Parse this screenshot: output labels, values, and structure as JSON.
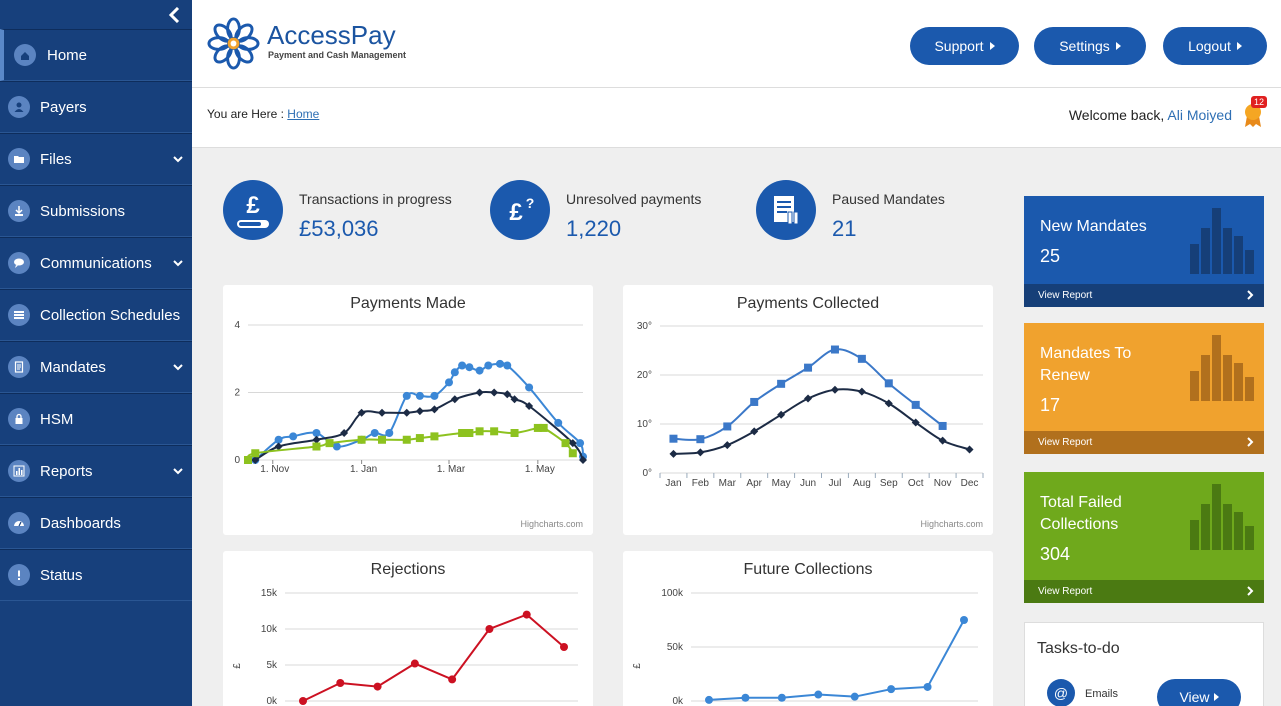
{
  "brand": {
    "name": "AccessPay",
    "tagline": "Payment and Cash Management"
  },
  "header": {
    "buttons": [
      "Support",
      "Settings",
      "Logout"
    ]
  },
  "sidebar": {
    "items": [
      {
        "label": "Home",
        "icon": "home-icon",
        "has_submenu": false,
        "active": true
      },
      {
        "label": "Payers",
        "icon": "user-icon",
        "has_submenu": false
      },
      {
        "label": "Files",
        "icon": "folder-icon",
        "has_submenu": true
      },
      {
        "label": "Submissions",
        "icon": "download-icon",
        "has_submenu": false
      },
      {
        "label": "Communications",
        "icon": "chat-icon",
        "has_submenu": true
      },
      {
        "label": "Collection Schedules",
        "icon": "list-icon",
        "has_submenu": false
      },
      {
        "label": "Mandates",
        "icon": "document-icon",
        "has_submenu": true
      },
      {
        "label": "HSM",
        "icon": "lock-icon",
        "has_submenu": false
      },
      {
        "label": "Reports",
        "icon": "bar-chart-icon",
        "has_submenu": true
      },
      {
        "label": "Dashboards",
        "icon": "dashboard-icon",
        "has_submenu": false
      },
      {
        "label": "Status",
        "icon": "exclamation-icon",
        "has_submenu": false
      }
    ]
  },
  "breadcrumb": {
    "prefix": "You are Here :",
    "link": "Home"
  },
  "welcome": {
    "text": "Welcome back,",
    "user": "Ali Moiyed",
    "notifications": "12"
  },
  "stats": [
    {
      "label": "Transactions in progress",
      "value": "£53,036",
      "icon": "pound-progress-icon"
    },
    {
      "label": "Unresolved payments",
      "value": "1,220",
      "icon": "pound-question-icon"
    },
    {
      "label": "Paused Mandates",
      "value": "21",
      "icon": "paused-document-icon"
    }
  ],
  "cards": [
    {
      "title": "New Mandates",
      "count": "25",
      "link": "View Report",
      "color": "#1b59ad",
      "footer_color": "#163f78",
      "bar_color": "#163f78"
    },
    {
      "title": "Mandates To Renew",
      "count": "17",
      "link": "View Report",
      "color": "#f0a22e",
      "footer_color": "#b1701d",
      "bar_color": "#b1701d"
    },
    {
      "title": "Total Failed Collections",
      "count": "304",
      "link": "View Report",
      "color": "#6fa91c",
      "footer_color": "#4b7a12",
      "bar_color": "#4b7a12"
    }
  ],
  "tasks": {
    "title": "Tasks-to-do",
    "item_label": "Emails",
    "button": "View"
  },
  "credit": "Highcharts.com",
  "chart_data": [
    {
      "type": "line",
      "title": "Payments Made",
      "x_ticks": [
        "1. Nov",
        "1. Jan",
        "1. Mar",
        "1. May"
      ],
      "y_ticks": [
        "0",
        "2",
        "4"
      ],
      "ylim": [
        0,
        4
      ],
      "series": [
        {
          "color": "#3b87d6",
          "marker": "circle",
          "x": [
            "2015-10-20",
            "2015-11-05",
            "2015-11-15",
            "2015-12-01",
            "2015-12-15",
            "2016-01-01",
            "2016-01-10",
            "2016-01-20",
            "2016-02-01",
            "2016-02-10",
            "2016-02-20",
            "2016-03-01",
            "2016-03-05",
            "2016-03-10",
            "2016-03-15",
            "2016-03-22",
            "2016-03-28",
            "2016-04-05",
            "2016-04-10",
            "2016-04-25",
            "2016-05-15",
            "2016-05-30",
            "2016-06-01"
          ],
          "y": [
            0.0,
            0.6,
            0.7,
            0.8,
            0.4,
            0.6,
            0.8,
            0.8,
            1.9,
            1.9,
            1.9,
            2.3,
            2.6,
            2.8,
            2.75,
            2.65,
            2.8,
            2.85,
            2.8,
            2.15,
            1.1,
            0.5,
            0.1
          ]
        },
        {
          "color": "#1c2b45",
          "marker": "diamond",
          "x": [
            "2015-10-20",
            "2015-11-05",
            "2015-12-01",
            "2015-12-20",
            "2016-01-01",
            "2016-01-15",
            "2016-02-01",
            "2016-02-10",
            "2016-02-20",
            "2016-03-05",
            "2016-03-22",
            "2016-04-01",
            "2016-04-10",
            "2016-04-15",
            "2016-04-25",
            "2016-05-25",
            "2016-06-01"
          ],
          "y": [
            0.0,
            0.4,
            0.6,
            0.8,
            1.4,
            1.4,
            1.4,
            1.45,
            1.5,
            1.8,
            2.0,
            2.0,
            1.95,
            1.8,
            1.6,
            0.5,
            0.0
          ]
        },
        {
          "color": "#8dc21f",
          "marker": "square",
          "x": [
            "2015-10-15",
            "2015-10-20",
            "2015-12-01",
            "2015-12-10",
            "2016-01-01",
            "2016-01-15",
            "2016-02-01",
            "2016-02-10",
            "2016-02-20",
            "2016-03-10",
            "2016-03-15",
            "2016-03-22",
            "2016-04-01",
            "2016-04-15",
            "2016-05-01",
            "2016-05-05",
            "2016-05-20",
            "2016-05-25"
          ],
          "y": [
            0.0,
            0.2,
            0.4,
            0.5,
            0.6,
            0.6,
            0.6,
            0.65,
            0.7,
            0.8,
            0.8,
            0.85,
            0.85,
            0.8,
            0.95,
            0.95,
            0.5,
            0.2
          ]
        }
      ]
    },
    {
      "type": "line",
      "title": "Payments Collected",
      "categories": [
        "Jan",
        "Feb",
        "Mar",
        "Apr",
        "May",
        "Jun",
        "Jul",
        "Aug",
        "Sep",
        "Oct",
        "Nov",
        "Dec"
      ],
      "y_ticks": [
        "0°",
        "10°",
        "20°",
        "30°"
      ],
      "ylim": [
        0,
        30
      ],
      "series": [
        {
          "color": "#3b78c8",
          "marker": "square",
          "values": [
            7.0,
            6.9,
            9.5,
            14.5,
            18.2,
            21.5,
            25.2,
            23.3,
            18.3,
            13.9,
            9.6,
            null
          ]
        },
        {
          "color": "#1c2b45",
          "marker": "diamond",
          "values": [
            3.9,
            4.2,
            5.7,
            8.5,
            11.9,
            15.2,
            17.0,
            16.6,
            14.2,
            10.3,
            6.6,
            4.8
          ]
        }
      ]
    },
    {
      "type": "line",
      "title": "Rejections",
      "y_ticks": [
        "0k",
        "5k",
        "10k",
        "15k"
      ],
      "ylabel": "£",
      "ylim": [
        0,
        15000
      ],
      "series": [
        {
          "color": "#cc1122",
          "values": [
            0,
            2500,
            2000,
            5200,
            3000,
            10000,
            12000,
            7500
          ]
        }
      ]
    },
    {
      "type": "line",
      "title": "Future Collections",
      "y_ticks": [
        "0k",
        "50k",
        "100k"
      ],
      "ylabel": "£",
      "ylim": [
        0,
        100000
      ],
      "series": [
        {
          "color": "#3b87d6",
          "values": [
            1000,
            3000,
            3000,
            6000,
            4000,
            11000,
            13000,
            75000
          ]
        }
      ]
    }
  ]
}
